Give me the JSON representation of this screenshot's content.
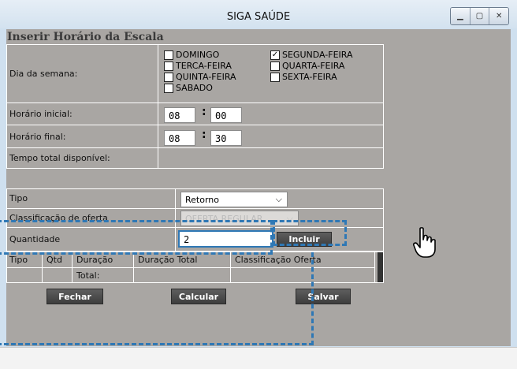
{
  "window": {
    "title": "SIGA SAÚDE",
    "controls": [
      "minimize-icon",
      "maximize-icon",
      "close-icon"
    ]
  },
  "form": {
    "title": "Inserir Horário da Escala"
  },
  "schedule": {
    "day_label": "Dia da semana:",
    "days": [
      {
        "label": "DOMINGO",
        "checked": false
      },
      {
        "label": "SEGUNDA-FEIRA",
        "checked": true
      },
      {
        "label": "TERCA-FEIRA",
        "checked": false
      },
      {
        "label": "QUARTA-FEIRA",
        "checked": false
      },
      {
        "label": "QUINTA-FEIRA",
        "checked": false
      },
      {
        "label": "SEXTA-FEIRA",
        "checked": false
      },
      {
        "label": "SABADO",
        "checked": false
      }
    ],
    "start_label": "Horário inicial:",
    "start_hour": "08",
    "start_min": "00",
    "end_label": "Horário final:",
    "end_hour": "08",
    "end_min": "30",
    "total_label": "Tempo total disponível:",
    "separator": ":"
  },
  "details": {
    "tipo_label": "Tipo",
    "tipo_value": "Retorno",
    "classificacao_label": "Classificação de oferta",
    "classificacao_value": "OFERTA REGULAR",
    "quantidade_label": "Quantidade",
    "quantidade_value": "2",
    "incluir_label": "Incluir"
  },
  "grid": {
    "headers": [
      "Tipo",
      "Qtd",
      "Duração",
      "Duração Total",
      "Classificação Oferta"
    ],
    "total_label": "Total:"
  },
  "actions": {
    "fechar": "Fechar",
    "calcular": "Calcular",
    "salvar": "Salvar"
  },
  "colors": {
    "highlight": "#2f78b5",
    "panel": "#a9a6a3",
    "button": "#4a4a4a"
  }
}
